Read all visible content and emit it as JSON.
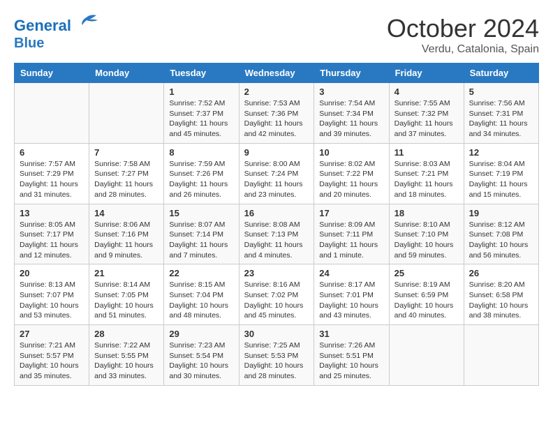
{
  "header": {
    "logo_line1": "General",
    "logo_line2": "Blue",
    "month": "October 2024",
    "location": "Verdu, Catalonia, Spain"
  },
  "weekdays": [
    "Sunday",
    "Monday",
    "Tuesday",
    "Wednesday",
    "Thursday",
    "Friday",
    "Saturday"
  ],
  "weeks": [
    [
      {
        "day": "",
        "info": ""
      },
      {
        "day": "",
        "info": ""
      },
      {
        "day": "1",
        "info": "Sunrise: 7:52 AM\nSunset: 7:37 PM\nDaylight: 11 hours and 45 minutes."
      },
      {
        "day": "2",
        "info": "Sunrise: 7:53 AM\nSunset: 7:36 PM\nDaylight: 11 hours and 42 minutes."
      },
      {
        "day": "3",
        "info": "Sunrise: 7:54 AM\nSunset: 7:34 PM\nDaylight: 11 hours and 39 minutes."
      },
      {
        "day": "4",
        "info": "Sunrise: 7:55 AM\nSunset: 7:32 PM\nDaylight: 11 hours and 37 minutes."
      },
      {
        "day": "5",
        "info": "Sunrise: 7:56 AM\nSunset: 7:31 PM\nDaylight: 11 hours and 34 minutes."
      }
    ],
    [
      {
        "day": "6",
        "info": "Sunrise: 7:57 AM\nSunset: 7:29 PM\nDaylight: 11 hours and 31 minutes."
      },
      {
        "day": "7",
        "info": "Sunrise: 7:58 AM\nSunset: 7:27 PM\nDaylight: 11 hours and 28 minutes."
      },
      {
        "day": "8",
        "info": "Sunrise: 7:59 AM\nSunset: 7:26 PM\nDaylight: 11 hours and 26 minutes."
      },
      {
        "day": "9",
        "info": "Sunrise: 8:00 AM\nSunset: 7:24 PM\nDaylight: 11 hours and 23 minutes."
      },
      {
        "day": "10",
        "info": "Sunrise: 8:02 AM\nSunset: 7:22 PM\nDaylight: 11 hours and 20 minutes."
      },
      {
        "day": "11",
        "info": "Sunrise: 8:03 AM\nSunset: 7:21 PM\nDaylight: 11 hours and 18 minutes."
      },
      {
        "day": "12",
        "info": "Sunrise: 8:04 AM\nSunset: 7:19 PM\nDaylight: 11 hours and 15 minutes."
      }
    ],
    [
      {
        "day": "13",
        "info": "Sunrise: 8:05 AM\nSunset: 7:17 PM\nDaylight: 11 hours and 12 minutes."
      },
      {
        "day": "14",
        "info": "Sunrise: 8:06 AM\nSunset: 7:16 PM\nDaylight: 11 hours and 9 minutes."
      },
      {
        "day": "15",
        "info": "Sunrise: 8:07 AM\nSunset: 7:14 PM\nDaylight: 11 hours and 7 minutes."
      },
      {
        "day": "16",
        "info": "Sunrise: 8:08 AM\nSunset: 7:13 PM\nDaylight: 11 hours and 4 minutes."
      },
      {
        "day": "17",
        "info": "Sunrise: 8:09 AM\nSunset: 7:11 PM\nDaylight: 11 hours and 1 minute."
      },
      {
        "day": "18",
        "info": "Sunrise: 8:10 AM\nSunset: 7:10 PM\nDaylight: 10 hours and 59 minutes."
      },
      {
        "day": "19",
        "info": "Sunrise: 8:12 AM\nSunset: 7:08 PM\nDaylight: 10 hours and 56 minutes."
      }
    ],
    [
      {
        "day": "20",
        "info": "Sunrise: 8:13 AM\nSunset: 7:07 PM\nDaylight: 10 hours and 53 minutes."
      },
      {
        "day": "21",
        "info": "Sunrise: 8:14 AM\nSunset: 7:05 PM\nDaylight: 10 hours and 51 minutes."
      },
      {
        "day": "22",
        "info": "Sunrise: 8:15 AM\nSunset: 7:04 PM\nDaylight: 10 hours and 48 minutes."
      },
      {
        "day": "23",
        "info": "Sunrise: 8:16 AM\nSunset: 7:02 PM\nDaylight: 10 hours and 45 minutes."
      },
      {
        "day": "24",
        "info": "Sunrise: 8:17 AM\nSunset: 7:01 PM\nDaylight: 10 hours and 43 minutes."
      },
      {
        "day": "25",
        "info": "Sunrise: 8:19 AM\nSunset: 6:59 PM\nDaylight: 10 hours and 40 minutes."
      },
      {
        "day": "26",
        "info": "Sunrise: 8:20 AM\nSunset: 6:58 PM\nDaylight: 10 hours and 38 minutes."
      }
    ],
    [
      {
        "day": "27",
        "info": "Sunrise: 7:21 AM\nSunset: 5:57 PM\nDaylight: 10 hours and 35 minutes."
      },
      {
        "day": "28",
        "info": "Sunrise: 7:22 AM\nSunset: 5:55 PM\nDaylight: 10 hours and 33 minutes."
      },
      {
        "day": "29",
        "info": "Sunrise: 7:23 AM\nSunset: 5:54 PM\nDaylight: 10 hours and 30 minutes."
      },
      {
        "day": "30",
        "info": "Sunrise: 7:25 AM\nSunset: 5:53 PM\nDaylight: 10 hours and 28 minutes."
      },
      {
        "day": "31",
        "info": "Sunrise: 7:26 AM\nSunset: 5:51 PM\nDaylight: 10 hours and 25 minutes."
      },
      {
        "day": "",
        "info": ""
      },
      {
        "day": "",
        "info": ""
      }
    ]
  ]
}
